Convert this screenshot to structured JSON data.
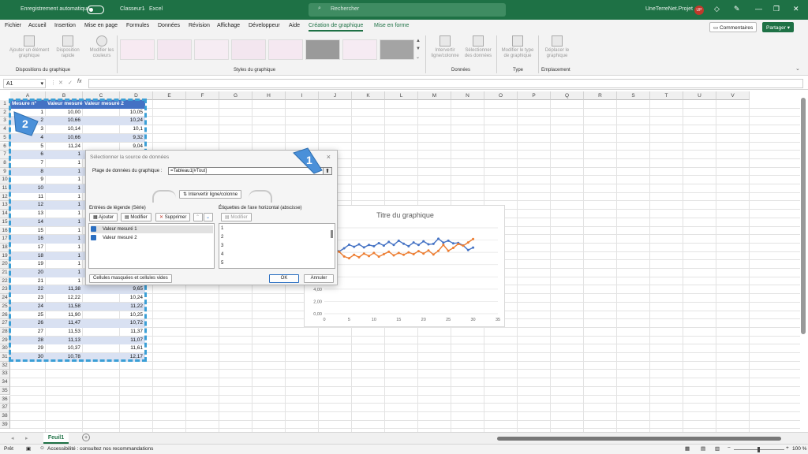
{
  "titlebar": {
    "autosave_label": "Enregistrement automatique",
    "filename": "Classeur1",
    "app": "Excel",
    "search_placeholder": "Rechercher",
    "user": "UneTerreNet.Projet",
    "avatar_initials": "UP"
  },
  "menu": {
    "items": [
      "Fichier",
      "Accueil",
      "Insertion",
      "Mise en page",
      "Formules",
      "Données",
      "Révision",
      "Affichage",
      "Développeur",
      "Aide",
      "Création de graphique",
      "Mise en forme"
    ],
    "comments": "Commentaires",
    "share": "Partager"
  },
  "ribbon": {
    "add_element": "Ajouter un élément graphique",
    "quick_layout": "Disposition rapide",
    "change_colors": "Modifier les couleurs",
    "group_layout": "Dispositions du graphique",
    "group_styles": "Styles du graphique",
    "switch_row_col": "Intervertir ligne/colonne",
    "select_data": "Sélectionner des données",
    "group_data": "Données",
    "change_type": "Modifier le type de graphique",
    "group_type": "Type",
    "move_chart": "Déplacer le graphique",
    "group_location": "Emplacement"
  },
  "formula": {
    "namebox": "A1",
    "fx": "fx"
  },
  "columns": [
    "A",
    "B",
    "C",
    "D",
    "E",
    "F",
    "G",
    "H",
    "I",
    "J",
    "K",
    "L",
    "M",
    "N",
    "O",
    "P",
    "Q",
    "R",
    "S",
    "T",
    "U",
    "V"
  ],
  "table": {
    "headers": [
      "Mesure n°",
      "Valeur mesuré 1",
      "Valeur mesuré 2"
    ],
    "rows": [
      [
        "1",
        "10,00",
        "10,05"
      ],
      [
        "2",
        "10,66",
        "10,24"
      ],
      [
        "3",
        "10,14",
        "10,1"
      ],
      [
        "4",
        "10,66",
        "9,32"
      ],
      [
        "5",
        "11,24",
        "9,04"
      ],
      [
        "6",
        "1",
        ""
      ],
      [
        "7",
        "1",
        ""
      ],
      [
        "8",
        "1",
        ""
      ],
      [
        "9",
        "1",
        ""
      ],
      [
        "10",
        "1",
        ""
      ],
      [
        "11",
        "1",
        ""
      ],
      [
        "12",
        "1",
        ""
      ],
      [
        "13",
        "1",
        ""
      ],
      [
        "14",
        "1",
        ""
      ],
      [
        "15",
        "1",
        ""
      ],
      [
        "16",
        "1",
        ""
      ],
      [
        "17",
        "1",
        ""
      ],
      [
        "18",
        "1",
        ""
      ],
      [
        "19",
        "1",
        ""
      ],
      [
        "20",
        "1",
        ""
      ],
      [
        "21",
        "1",
        ""
      ],
      [
        "22",
        "11,38",
        "9,65"
      ],
      [
        "23",
        "12,22",
        "10,24"
      ],
      [
        "24",
        "11,58",
        "11,22"
      ],
      [
        "25",
        "11,90",
        "10,25"
      ],
      [
        "26",
        "11,47",
        "10,72"
      ],
      [
        "27",
        "11,53",
        "11,37"
      ],
      [
        "28",
        "11,13",
        "11,07"
      ],
      [
        "29",
        "10,37",
        "11,61"
      ],
      [
        "30",
        "10,78",
        "12,17"
      ]
    ]
  },
  "chart_data": {
    "type": "line",
    "title": "Titre du graphique",
    "x": [
      1,
      2,
      3,
      4,
      5,
      6,
      7,
      8,
      9,
      10,
      11,
      12,
      13,
      14,
      15,
      16,
      17,
      18,
      19,
      20,
      21,
      22,
      23,
      24,
      25,
      26,
      27,
      28,
      29,
      30
    ],
    "series": [
      {
        "color": "#4472c4",
        "values": [
          10.0,
          10.66,
          10.14,
          10.66,
          11.24,
          10.9,
          11.3,
          10.8,
          11.2,
          11.0,
          11.5,
          11.1,
          11.7,
          11.2,
          11.9,
          11.4,
          11.0,
          11.6,
          11.2,
          11.8,
          11.3,
          11.38,
          12.22,
          11.58,
          11.9,
          11.47,
          11.53,
          11.13,
          10.37,
          10.78
        ]
      },
      {
        "color": "#ed7d31",
        "values": [
          10.05,
          10.24,
          10.1,
          9.32,
          9.04,
          9.6,
          9.2,
          9.8,
          9.4,
          9.9,
          9.3,
          9.7,
          10.1,
          9.5,
          9.9,
          9.6,
          10.0,
          9.7,
          10.2,
          9.8,
          10.3,
          9.65,
          10.24,
          11.22,
          10.25,
          10.72,
          11.37,
          11.07,
          11.61,
          12.17
        ]
      }
    ],
    "visible_y_ticks": [
      "0,00",
      "2,00",
      "4,00"
    ],
    "x_ticks": [
      0,
      5,
      10,
      15,
      20,
      25,
      30,
      35
    ],
    "xlim": [
      0,
      35
    ],
    "ylim": [
      0,
      14
    ]
  },
  "dialog": {
    "title": "Sélectionner la source de données",
    "close": "×",
    "range_label": "Plage de données du graphique :",
    "range_value": "=Tableau1[#Tout]",
    "switch": "Intervertir ligne/colonne",
    "legend_label": "Entrées de légende (Série)",
    "axis_label": "Étiquettes de l'axe horizontal (abscisse)",
    "add": "Ajouter",
    "edit": "Modifier",
    "remove": "Supprimer",
    "edit2": "Modifier",
    "series": [
      "Valeur mesuré 1",
      "Valeur mesuré 2"
    ],
    "axis_items": [
      "1",
      "2",
      "3",
      "4",
      "5"
    ],
    "hidden_cells": "Cellules masquées et cellules vides",
    "ok": "OK",
    "cancel": "Annuler"
  },
  "callouts": {
    "one": "1",
    "two": "2"
  },
  "sheet": {
    "tab": "Feuil1",
    "add": "+"
  },
  "status": {
    "ready": "Prêt",
    "accessibility": "Accessibilité : consultez nos recommandations",
    "zoom": "100 %"
  }
}
